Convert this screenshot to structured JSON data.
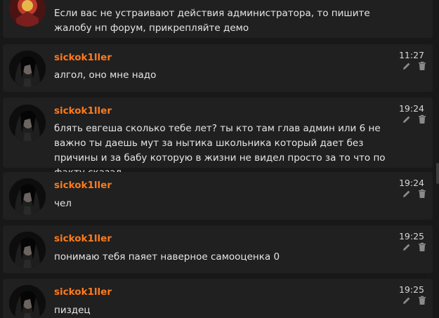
{
  "messages": [
    {
      "author": "",
      "text": "Если вас не устраивают действия администратора, то пишите жалобу нп форум, прикрепляйте демо",
      "time": ""
    },
    {
      "author": "sickok1ller",
      "text": "алгол, оно мне надо",
      "time": "11:27"
    },
    {
      "author": "sickok1ller",
      "text": "блять евгеша сколько тебе лет? ты кто там глав админ или 6 не важно ты даешь мут за нытика школьника который дает без причины и за бабу которую в жизни не видел просто за то что по факту сказал",
      "time": "19:24"
    },
    {
      "author": "sickok1ller",
      "text": "чел",
      "time": "19:24"
    },
    {
      "author": "sickok1ller",
      "text": "понимаю тебя паяет наверное самооценка 0",
      "time": "19:25"
    },
    {
      "author": "sickok1ller",
      "text": "пиздец",
      "time": "19:25"
    }
  ],
  "icons": {
    "edit": "pencil-icon",
    "delete": "trash-icon"
  },
  "colors": {
    "author": "#ff7a1a",
    "text": "#e6e6e6",
    "card": "#202020",
    "background": "#181818"
  }
}
